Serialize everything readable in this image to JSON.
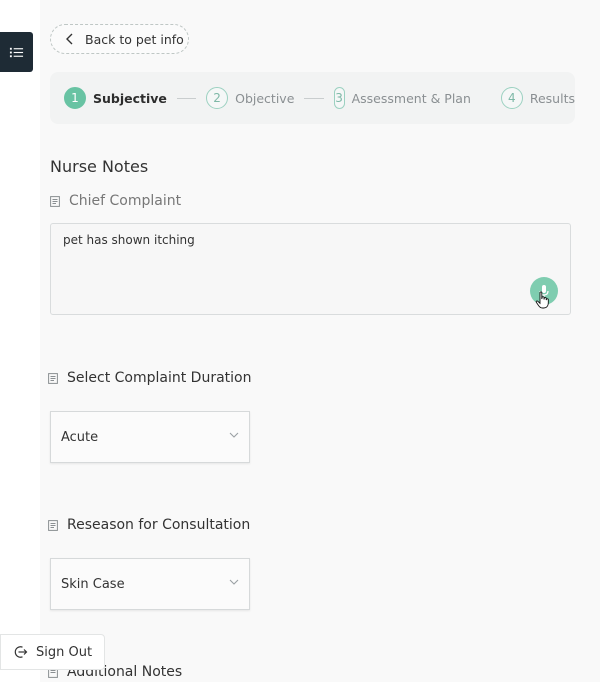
{
  "nav": {
    "back_label": "Back to pet info"
  },
  "stepper": {
    "steps": [
      {
        "num": "1",
        "label": "Subjective"
      },
      {
        "num": "2",
        "label": "Objective"
      },
      {
        "num": "3",
        "label": "Assessment & Plan"
      },
      {
        "num": "4",
        "label": "Results"
      }
    ],
    "active_index": 0
  },
  "nurse_notes": {
    "title": "Nurse Notes",
    "chief_complaint_label": "Chief Complaint",
    "chief_complaint_value": "pet has shown itching",
    "duration_label": "Select Complaint Duration",
    "duration_value": "Acute",
    "reason_label": "Reseason for Consultation",
    "reason_value": "Skin Case",
    "additional_label": "Additional Notes"
  },
  "sidebar": {
    "signout_label": "Sign Out"
  },
  "colors": {
    "accent": "#68c3a3",
    "menu_bg": "#1e2b35",
    "label_muted": "#777777"
  },
  "icons": {
    "menu": "list-icon",
    "back": "chevron-left-icon",
    "field": "note-icon",
    "mic": "mic-icon",
    "cursor": "hand-pointer-icon",
    "dropdown": "chevron-down-icon",
    "signout": "sign-out-icon"
  }
}
